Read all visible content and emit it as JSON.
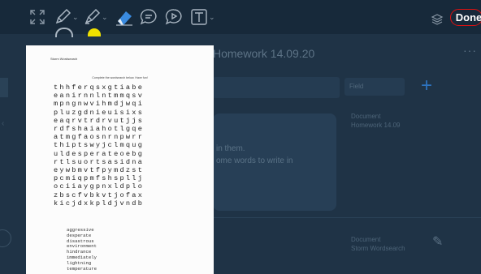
{
  "toolbar": {
    "tools": [
      {
        "icon": "fullscreen-icon"
      },
      {
        "icon": "pen-icon"
      },
      {
        "icon": "highlighter-icon"
      },
      {
        "icon": "eraser-icon"
      },
      {
        "icon": "comment-icon"
      },
      {
        "icon": "play-icon"
      },
      {
        "icon": "text-box-icon"
      }
    ],
    "caret": "⌄",
    "layers_icon": "layers-icon",
    "done_label": "Done",
    "colors": {
      "eraser_accent": "#3a8be0",
      "done_outline": "#dd1111",
      "pen_dot": "#f0e100"
    }
  },
  "background": {
    "title": "Homework 14.09.20",
    "menu": "···",
    "select_placeholder": "Field",
    "card_text_1": "in them.",
    "card_text_2": "ome words to write in",
    "side_label_1": "Document",
    "side_label_2": "Homework 14.09",
    "bottom_label_1": "Document",
    "bottom_label_2": "Storm Wordsearch"
  },
  "document": {
    "title": "Storm Wordsearch",
    "instructions": "Complete the wordsearch below. Have fun!",
    "grid": [
      "thhferqsxgtiabe",
      "eanirnnlntmmqsv",
      "mpngnwvihmdjwqi",
      "pluzgdnieuisixs",
      "eaqrvtrdrvutjjs",
      "rdfshaiahotlgqe",
      "atmgfaosnrnpwrr",
      "thiptswyjclmqug",
      "uldesperateoebg",
      "rtlsuortsasidna",
      "eywbmvtfpymdzst",
      "pcmiqpmfshspllj",
      "ociiaygpnxldplo",
      "zbscfvbkvtjofax",
      "kicjdxkpldjvndb"
    ],
    "words": [
      "aggressive",
      "desperate",
      "disastrous",
      "environment",
      "hindrance",
      "immediately",
      "lightning",
      "temperature"
    ]
  }
}
